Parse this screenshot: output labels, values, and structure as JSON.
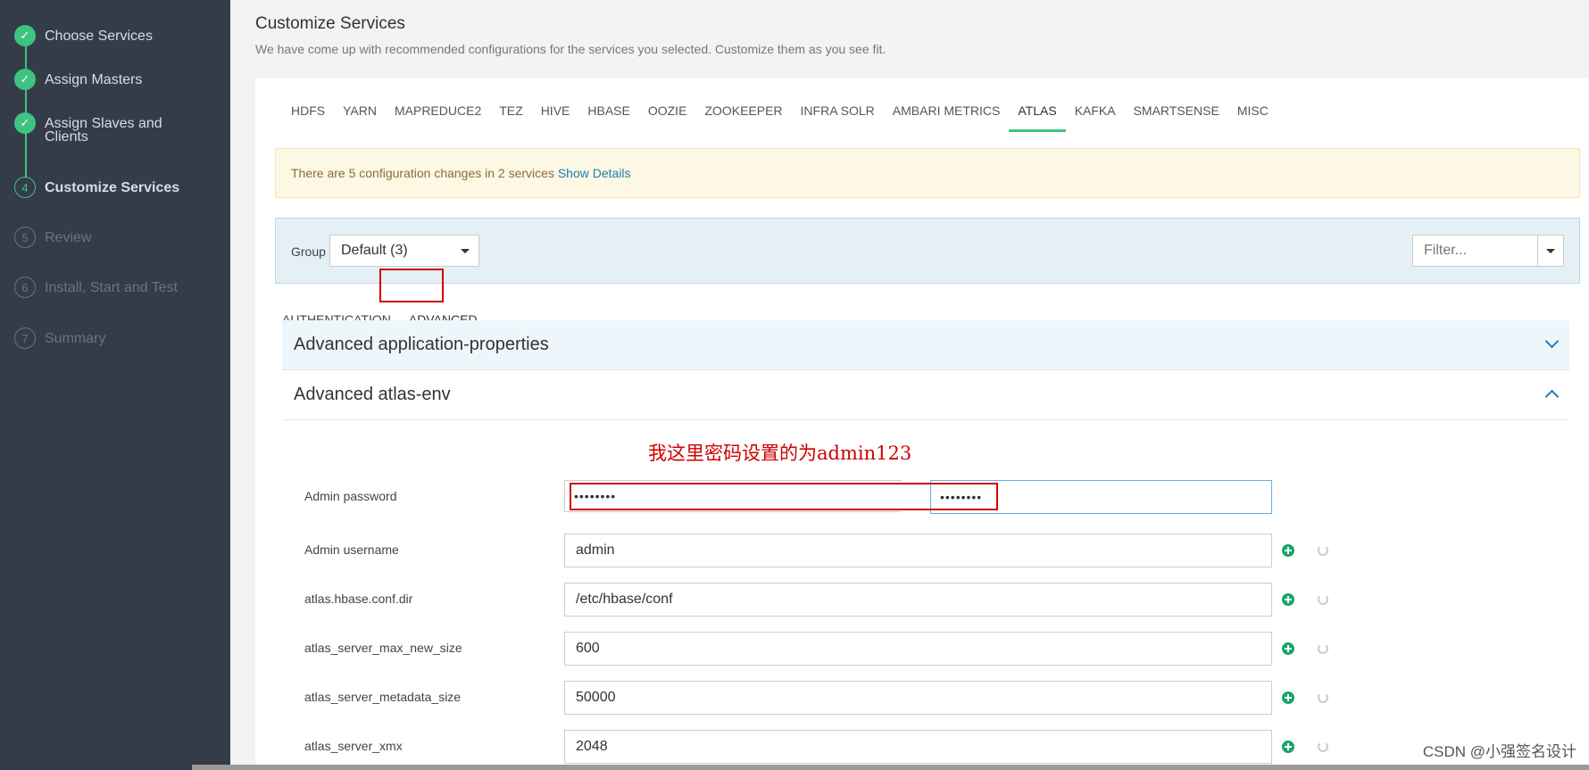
{
  "wizard": {
    "steps": [
      {
        "num": "1",
        "label": "Choose Services",
        "state": "done"
      },
      {
        "num": "2",
        "label": "Assign Masters",
        "state": "done"
      },
      {
        "num": "3",
        "label": "Assign Slaves and Clients",
        "state": "done"
      },
      {
        "num": "4",
        "label": "Customize Services",
        "state": "current"
      },
      {
        "num": "5",
        "label": "Review",
        "state": "pending"
      },
      {
        "num": "6",
        "label": "Install, Start and Test",
        "state": "pending"
      },
      {
        "num": "7",
        "label": "Summary",
        "state": "pending"
      }
    ]
  },
  "page": {
    "title": "Customize Services",
    "subtitle": "We have come up with recommended configurations for the services you selected. Customize them as you see fit."
  },
  "service_tabs": [
    "HDFS",
    "YARN",
    "MAPREDUCE2",
    "TEZ",
    "HIVE",
    "HBASE",
    "OOZIE",
    "ZOOKEEPER",
    "INFRA SOLR",
    "AMBARI METRICS",
    "ATLAS",
    "KAFKA",
    "SMARTSENSE",
    "MISC"
  ],
  "active_service_tab": "ATLAS",
  "alert": {
    "text": "There are 5 configuration changes in 2 services",
    "link": "Show Details"
  },
  "group": {
    "label": "Group",
    "value": "Default (3)",
    "filter_placeholder": "Filter..."
  },
  "config_tabs": {
    "authentication": "AUTHENTICATION",
    "advanced": "ADVANCED"
  },
  "sections": {
    "app_props": "Advanced application-properties",
    "atlas_env": "Advanced atlas-env"
  },
  "annotation": "我这里密码设置的为admin123",
  "properties": [
    {
      "label": "Admin username",
      "value": "admin"
    },
    {
      "label": "atlas.hbase.conf.dir",
      "value": "/etc/hbase/conf"
    },
    {
      "label": "atlas_server_max_new_size",
      "value": "600"
    },
    {
      "label": "atlas_server_metadata_size",
      "value": "50000"
    },
    {
      "label": "atlas_server_xmx",
      "value": "2048"
    }
  ],
  "password": {
    "label": "Admin password",
    "masked": "••••••••",
    "confirm_masked": "••••••••"
  },
  "watermark": "CSDN @小强签名设计",
  "colors": {
    "accent": "#3fc380",
    "sidebar": "#343c4a",
    "annotation": "#d00000"
  }
}
